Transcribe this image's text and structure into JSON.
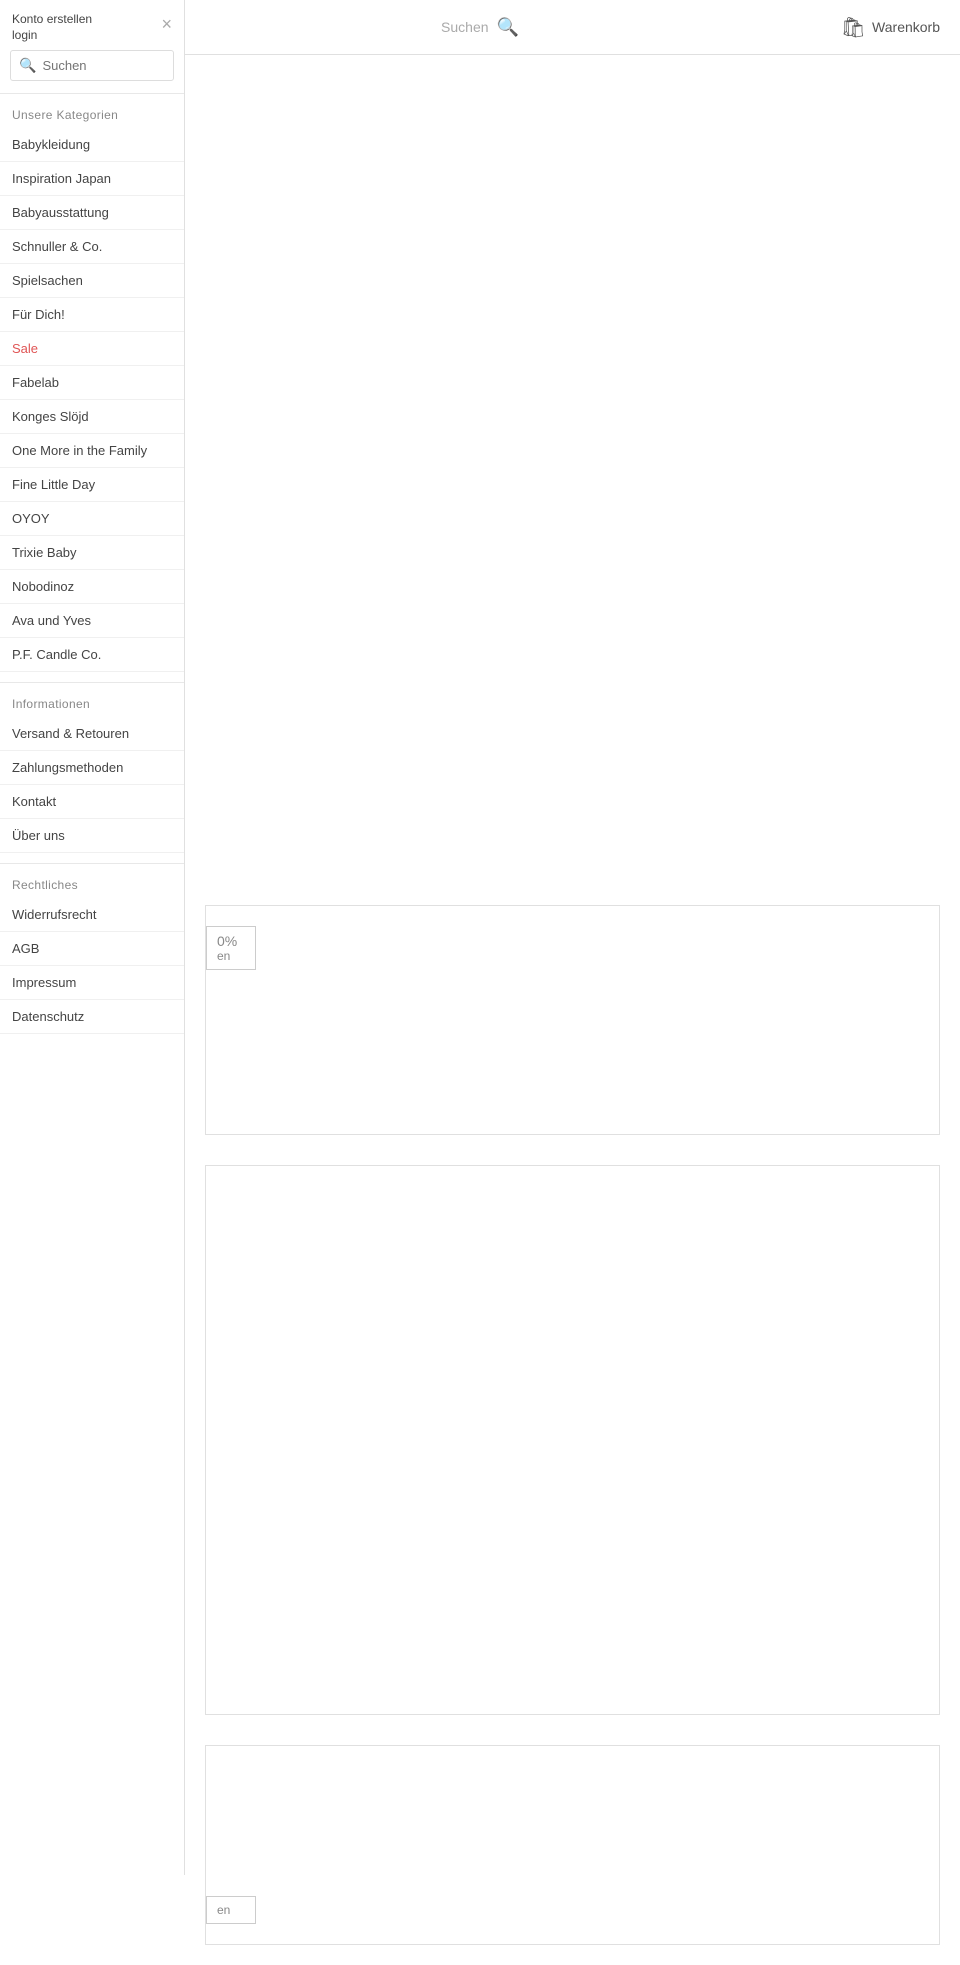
{
  "header": {
    "search_placeholder": "Suchen",
    "search_label": "Suchen",
    "cart_label": "Warenkorb"
  },
  "sidebar": {
    "konto_label": "Konto erstellen",
    "login_label": "login",
    "search_placeholder": "Suchen",
    "close_icon": "×",
    "categories_heading": "Unsere Kategorien",
    "categories": [
      {
        "label": "Babykleidung",
        "id": "babykleidung",
        "style": "normal"
      },
      {
        "label": "Inspiration Japan",
        "id": "inspiration-japan",
        "style": "normal"
      },
      {
        "label": "Babyausstattung",
        "id": "babyausstattung",
        "style": "normal"
      },
      {
        "label": "Schnuller & Co.",
        "id": "schnuller-co",
        "style": "normal"
      },
      {
        "label": "Spielsachen",
        "id": "spielsachen",
        "style": "normal"
      },
      {
        "label": "Für Dich!",
        "id": "fuer-dich",
        "style": "normal"
      },
      {
        "label": "Sale",
        "id": "sale",
        "style": "sale"
      },
      {
        "label": "Fabelab",
        "id": "fabelab",
        "style": "normal"
      },
      {
        "label": "Konges Slöjd",
        "id": "konges-slojd",
        "style": "normal"
      },
      {
        "label": "One More in the Family",
        "id": "one-more-family",
        "style": "normal"
      },
      {
        "label": "Fine Little Day",
        "id": "fine-little-day",
        "style": "normal"
      },
      {
        "label": "OYOY",
        "id": "oyoy",
        "style": "normal"
      },
      {
        "label": "Trixie Baby",
        "id": "trixie-baby",
        "style": "normal"
      },
      {
        "label": "Nobodinoz",
        "id": "nobodinoz",
        "style": "normal"
      },
      {
        "label": "Ava und Yves",
        "id": "ava-und-yves",
        "style": "normal"
      },
      {
        "label": "P.F. Candle Co.",
        "id": "pf-candle-co",
        "style": "normal"
      }
    ],
    "info_heading": "Informationen",
    "info_items": [
      {
        "label": "Versand & Retouren",
        "id": "versand-retouren"
      },
      {
        "label": "Zahlungsmethoden",
        "id": "zahlungsmethoden"
      },
      {
        "label": "Kontakt",
        "id": "kontakt"
      },
      {
        "label": "Über uns",
        "id": "uber-uns"
      }
    ],
    "legal_heading": "Rechtliches",
    "legal_items": [
      {
        "label": "Widerrufsrecht",
        "id": "widerrufsrecht"
      },
      {
        "label": "AGB",
        "id": "agb"
      },
      {
        "label": "Impressum",
        "id": "impressum"
      },
      {
        "label": "Datenschutz",
        "id": "datenschutz"
      }
    ]
  },
  "promo": {
    "badge1_text1": "0%",
    "badge1_text2": "en",
    "badge2_text": "en",
    "sale_color": "#e05555"
  }
}
